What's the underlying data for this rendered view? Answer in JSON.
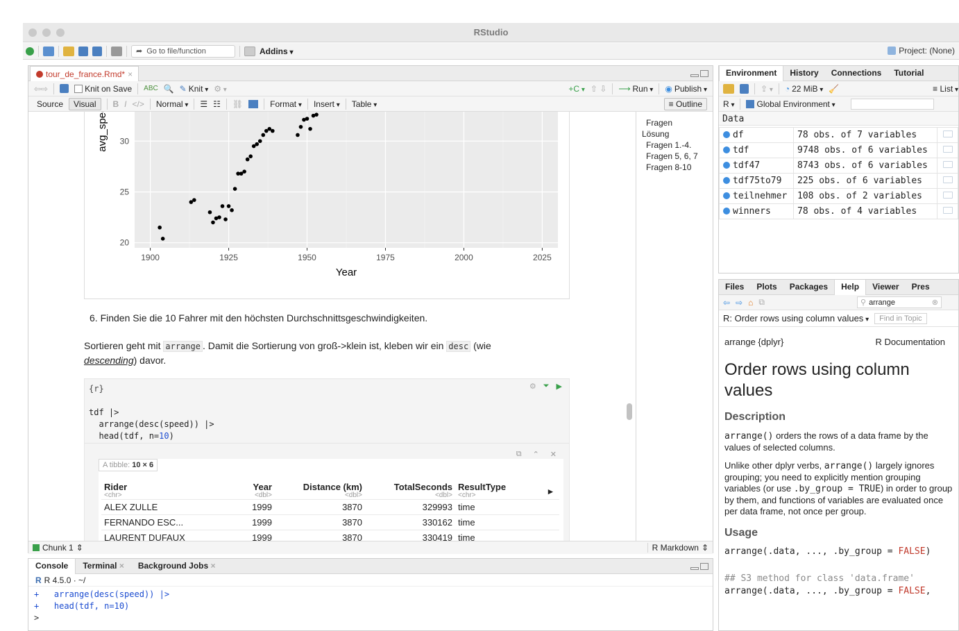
{
  "window": {
    "title": "RStudio"
  },
  "main_toolbar": {
    "go_to_file": "Go to file/function",
    "addins": "Addins",
    "project": "Project: (None)"
  },
  "editor": {
    "tab_name": "tour_de_france.Rmd*",
    "knit_on_save": "Knit on Save",
    "knit": "Knit",
    "run": "Run",
    "publish": "Publish",
    "source_mode": "Source",
    "visual_mode": "Visual",
    "paragraph_style": "Normal",
    "format_menu": "Format",
    "insert_menu": "Insert",
    "table_menu": "Table",
    "outline_btn": "Outline",
    "outline": [
      "Fragen",
      "Lösung",
      "Fragen 1.-4.",
      "Fragen 5, 6, 7",
      "Fragen 8-10"
    ],
    "question_6": "6. Finden Sie die 10 Fahrer mit den höchsten Durchschnittsgeschwindigkeiten.",
    "para_pre": "Sortieren geht mit ",
    "para_code1": "arrange",
    "para_mid": ". Damit die Sortierung von groß->klein ist, kleben wir ein ",
    "para_code2": "desc",
    "para_post": " (wie",
    "para_em": "descending",
    "para_end": ") davor.",
    "chunk_header": "{r}",
    "code_lines": [
      "tdf |>",
      "  arrange(desc(speed)) |>",
      "  head(tdf, n=",
      "10",
      ")"
    ],
    "tibble_label": "A tibble:",
    "tibble_dims": "10 × 6",
    "chunk_status": "Chunk 1",
    "doc_type": "R Markdown"
  },
  "tibble": {
    "columns": [
      {
        "name": "Rider",
        "type": "<chr>"
      },
      {
        "name": "Year",
        "type": "<dbl>"
      },
      {
        "name": "Distance (km)",
        "type": "<dbl>"
      },
      {
        "name": "TotalSeconds",
        "type": "<dbl>"
      },
      {
        "name": "ResultType",
        "type": "<chr>"
      }
    ],
    "rows": [
      [
        "ALEX ZULLE",
        "1999",
        "3870",
        "329993",
        "time"
      ],
      [
        "FERNANDO ESC...",
        "1999",
        "3870",
        "330162",
        "time"
      ],
      [
        "LAURENT DUFAUX",
        "1999",
        "3870",
        "330419",
        "time"
      ]
    ]
  },
  "chart_data": {
    "type": "scatter",
    "xlabel": "Year",
    "ylabel": "avg_speed",
    "xticks": [
      1900,
      1925,
      1950,
      1975,
      2000,
      2025
    ],
    "yticks": [
      20,
      25,
      30
    ],
    "xlim": [
      1895,
      2030
    ],
    "ylim": [
      19.5,
      33.5
    ],
    "x": [
      1903,
      1904,
      1913,
      1914,
      1919,
      1920,
      1921,
      1922,
      1923,
      1924,
      1925,
      1926,
      1927,
      1928,
      1929,
      1930,
      1931,
      1932,
      1933,
      1934,
      1935,
      1936,
      1937,
      1938,
      1939,
      1947,
      1948,
      1949,
      1950,
      1951,
      1952,
      1953
    ],
    "y": [
      21.5,
      20.4,
      24.0,
      24.2,
      23.0,
      22.0,
      22.4,
      22.5,
      23.6,
      22.3,
      23.6,
      23.2,
      25.3,
      26.8,
      26.8,
      27.0,
      28.2,
      28.5,
      29.5,
      29.7,
      30.0,
      30.6,
      31.0,
      31.2,
      31.0,
      30.6,
      31.4,
      32.1,
      32.2,
      31.2,
      32.5,
      32.6
    ]
  },
  "console": {
    "tabs": [
      "Console",
      "Terminal",
      "Background Jobs"
    ],
    "r_version": "R 4.5.0 · ~/",
    "lines": [
      "+   arrange(desc(speed)) |>",
      "+   head(tdf, n=10)",
      "> "
    ]
  },
  "env": {
    "tabs": [
      "Environment",
      "History",
      "Connections",
      "Tutorial"
    ],
    "memory": "22 MiB",
    "list_mode": "List",
    "lang": "R",
    "scope": "Global Environment",
    "section": "Data",
    "items": [
      {
        "name": "df",
        "value": "78 obs. of 7 variables"
      },
      {
        "name": "tdf",
        "value": "9748 obs. of 6 variables"
      },
      {
        "name": "tdf47",
        "value": "8743 obs. of 6 variables"
      },
      {
        "name": "tdf75to79",
        "value": "225 obs. of 6 variables"
      },
      {
        "name": "teilnehmer",
        "value": "108 obs. of 2 variables"
      },
      {
        "name": "winners",
        "value": "78 obs. of 4 variables"
      }
    ]
  },
  "help": {
    "tabs": [
      "Files",
      "Plots",
      "Packages",
      "Help",
      "Viewer",
      "Pres"
    ],
    "search_value": "arrange",
    "topic": "R: Order rows using column values",
    "find_placeholder": "Find in Topic",
    "pkg": "arrange {dplyr}",
    "doc_label": "R Documentation",
    "title": "Order rows using column values",
    "desc_heading": "Description",
    "desc1_code": "arrange()",
    "desc1_text": " orders the rows of a data frame by the values of selected columns.",
    "desc2_a": "Unlike other dplyr verbs, ",
    "desc2_code": "arrange()",
    "desc2_b": " largely ignores grouping; you need to explicitly mention grouping variables (or use ",
    "desc2_code2": ".by_group = TRUE",
    "desc2_c": ") in order to group by them, and functions of variables are evaluated once per data frame, not once per group.",
    "usage_heading": "Usage",
    "usage1": "arrange(.data, ..., .by_group = ",
    "usage1_val": "FALSE",
    "usage1_end": ")",
    "usage_comment": "## S3 method for class 'data.frame'",
    "usage2": "arrange(.data, ..., .by_group = ",
    "usage2_val": "FALSE",
    "usage2_end": ","
  }
}
